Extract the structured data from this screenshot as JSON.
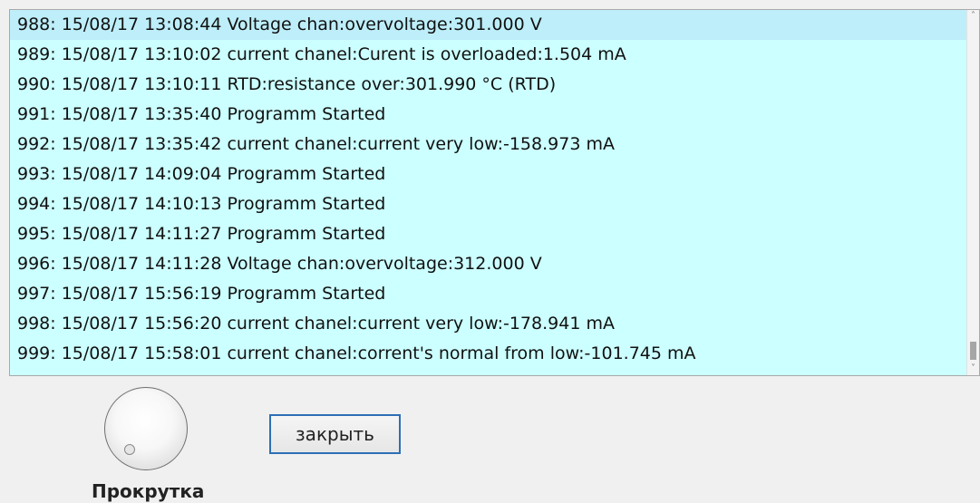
{
  "log": {
    "entries": [
      "988: 15/08/17 13:08:44 Voltage chan:overvoltage:301.000 V",
      "989: 15/08/17 13:10:02 current chanel:Curent is overloaded:1.504 mA",
      "990: 15/08/17 13:10:11 RTD:resistance over:301.990 °C (RTD)",
      "991: 15/08/17 13:35:40 Programm Started",
      "992: 15/08/17 13:35:42 current chanel:current very low:-158.973 mA",
      "993: 15/08/17 14:09:04 Programm Started",
      "994: 15/08/17 14:10:13 Programm Started",
      "995: 15/08/17 14:11:27 Programm Started",
      "996: 15/08/17 14:11:28 Voltage chan:overvoltage:312.000 V",
      "997: 15/08/17 15:56:19 Programm Started",
      "998: 15/08/17 15:56:20 current chanel:current very low:-178.941 mA",
      "999: 15/08/17 15:58:01 current chanel:corrent's normal from low:-101.745 mA"
    ]
  },
  "scrollbar": {
    "up_icon": "chevron-up-icon",
    "up_glyph": "˄",
    "down_icon": "chevron-down-icon",
    "down_glyph": "˅",
    "position_fraction": 0.97
  },
  "dial": {
    "label": "Прокрутка"
  },
  "close_button": {
    "label": "закрыть"
  },
  "colors": {
    "list_background": "#ccffff",
    "selected_row": "#bdeef9",
    "button_border": "#2d6fb6",
    "window_background": "#f0f0f0"
  }
}
